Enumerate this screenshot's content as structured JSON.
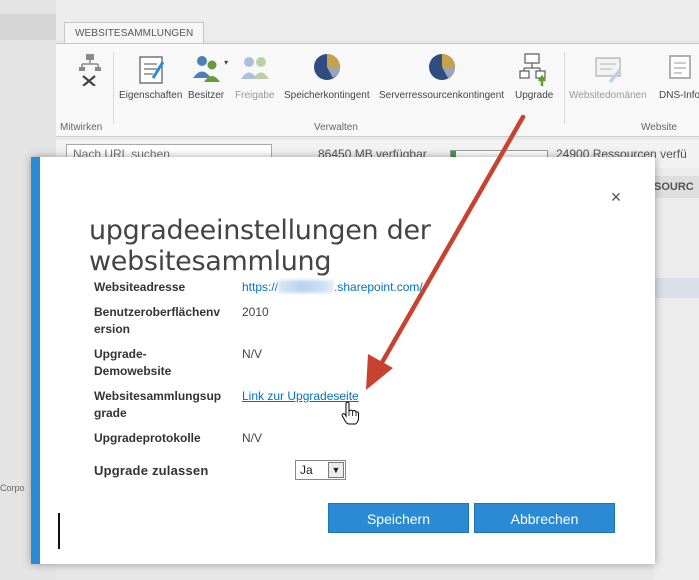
{
  "ribbon": {
    "tab_label": "WEBSITESAMMLUNGEN",
    "buttons": [
      {
        "label": "Eigenschaften",
        "icon": "properties-icon",
        "enabled": true
      },
      {
        "label": "Besitzer",
        "icon": "owners-icon",
        "enabled": true
      },
      {
        "label": "Freigabe",
        "icon": "sharing-icon",
        "enabled": false
      },
      {
        "label": "Speicherkontingent",
        "icon": "pie-chart-icon",
        "enabled": true
      },
      {
        "label": "Serverressourcenkontingent",
        "icon": "pie-chart-icon",
        "enabled": true
      },
      {
        "label": "Upgrade",
        "icon": "upgrade-icon",
        "enabled": true
      },
      {
        "label": "Websitedomänen",
        "icon": "site-domains-icon",
        "enabled": false
      },
      {
        "label": "DNS-Info",
        "icon": "dns-icon",
        "enabled": true
      }
    ],
    "groups": {
      "mitwirken": "Mitwirken",
      "verwalten": "Verwalten",
      "website": "Website"
    }
  },
  "background": {
    "search_placeholder": "Nach URL suchen",
    "storage_available": "86450 MB verfügbar",
    "resources_available": "24900 Ressourcen verfü",
    "column_header": "SOURC",
    "footer_fragment": "Corpo"
  },
  "dialog": {
    "title": "upgradeeinstellungen der websitesammlung",
    "close_label": "×",
    "fields": {
      "address_label": "Websiteadresse",
      "address_prefix": "https://",
      "address_suffix": ".sharepoint.com/",
      "ui_version_label_1": "Benutzeroberflächenv",
      "ui_version_label_2": "ersion",
      "ui_version_value": "2010",
      "demo_label_1": "Upgrade-",
      "demo_label_2": "Demowebsite",
      "demo_value": "N/V",
      "upgrade_label_1": "Websitesammlungsup",
      "upgrade_label_2": "grade",
      "upgrade_link": "Link zur Upgradeseite",
      "log_label": "Upgradeprotokolle",
      "log_value": "N/V",
      "allow_label": "Upgrade zulassen",
      "allow_value": "Ja"
    },
    "save_label": "Speichern",
    "cancel_label": "Abbrechen"
  },
  "colors": {
    "accent": "#2a8ad4",
    "link": "#0072c6",
    "annotation_arrow": "#c8432f"
  }
}
